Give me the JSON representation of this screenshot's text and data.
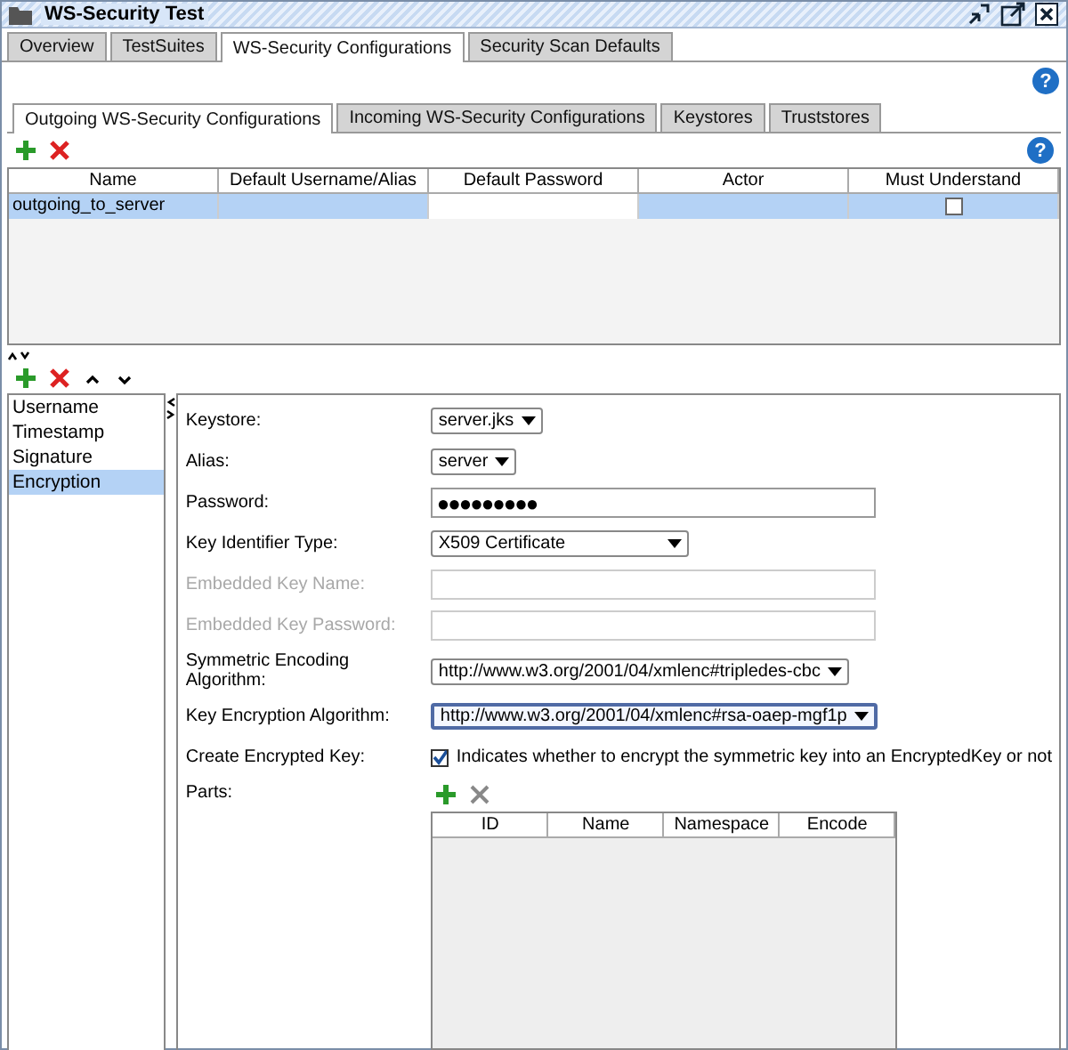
{
  "window": {
    "title": "WS-Security Test"
  },
  "tabs": [
    {
      "label": "Overview",
      "selected": false
    },
    {
      "label": "TestSuites",
      "selected": false
    },
    {
      "label": "WS-Security Configurations",
      "selected": true
    },
    {
      "label": "Security Scan Defaults",
      "selected": false
    }
  ],
  "sub_tabs": [
    {
      "label": "Outgoing WS-Security Configurations",
      "selected": true
    },
    {
      "label": "Incoming WS-Security Configurations",
      "selected": false
    },
    {
      "label": "Keystores",
      "selected": false
    },
    {
      "label": "Truststores",
      "selected": false
    }
  ],
  "table": {
    "columns": [
      "Name",
      "Default Username/Alias",
      "Default Password",
      "Actor",
      "Must Understand"
    ],
    "rows": [
      {
        "name": "outgoing_to_server",
        "selected": true,
        "must_understand": false
      }
    ]
  },
  "entries": [
    {
      "label": "Username",
      "selected": false
    },
    {
      "label": "Timestamp",
      "selected": false
    },
    {
      "label": "Signature",
      "selected": false
    },
    {
      "label": "Encryption",
      "selected": true
    }
  ],
  "form": [
    {
      "kind": "select",
      "label": "Keystore:",
      "value": "server.jks",
      "disabled": false,
      "focused": false
    },
    {
      "kind": "select",
      "label": "Alias:",
      "value": "server",
      "disabled": false,
      "focused": false
    },
    {
      "kind": "text",
      "label": "Password:",
      "value": "●●●●●●●●●",
      "disabled": false
    },
    {
      "kind": "select",
      "label": "Key Identifier Type:",
      "value": "X509 Certificate",
      "disabled": false,
      "focused": false
    },
    {
      "kind": "text",
      "label": "Embedded Key Name:",
      "disabled": true
    },
    {
      "kind": "text",
      "label": "Embedded Key Password:",
      "disabled": true
    },
    {
      "kind": "select",
      "label": "Symmetric Encoding Algorithm:",
      "value": "http://www.w3.org/2001/04/xmlenc#tripledes-cbc",
      "disabled": false,
      "focused": false
    },
    {
      "kind": "select",
      "label": "Key Encryption Algorithm:",
      "value": "http://www.w3.org/2001/04/xmlenc#rsa-oaep-mgf1p",
      "disabled": false,
      "focused": true
    },
    {
      "kind": "checkbox",
      "label": "Create Encrypted Key:",
      "value": "Indicates whether to encrypt the symmetric key into an EncryptedKey or not",
      "checked": true,
      "disabled": false
    }
  ],
  "help_buttons": [
    "?",
    "?"
  ],
  "parts": {
    "label": "Parts:",
    "columns": [
      "ID",
      "Name",
      "Namespace",
      "Encode"
    ]
  }
}
